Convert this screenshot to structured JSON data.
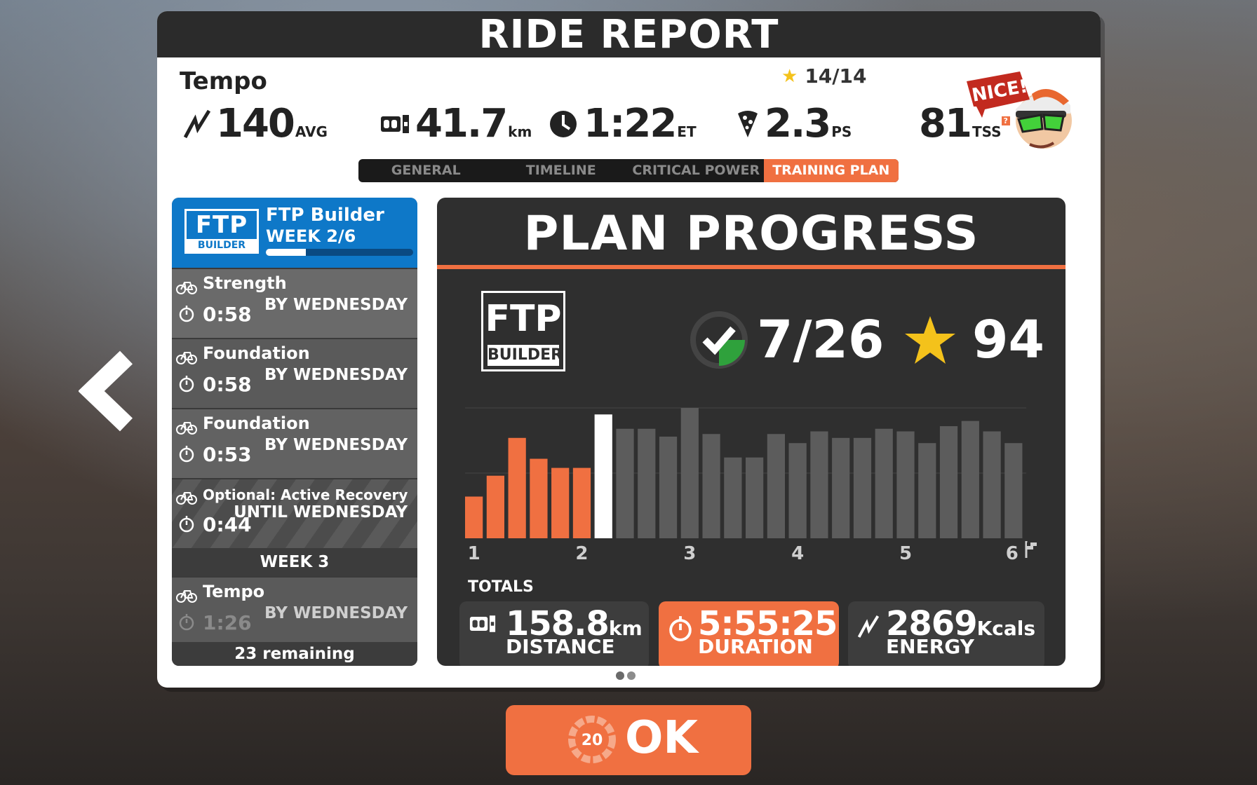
{
  "header": {
    "title": "RIDE REPORT"
  },
  "ride": {
    "name": "Tempo",
    "stars": "14/14",
    "power": "140",
    "power_unit": "AVG",
    "distance": "41.7",
    "distance_unit": "km",
    "time": "1:22",
    "time_unit": "ET",
    "pizza": "2.3",
    "pizza_unit": "PS",
    "tss": "81",
    "tss_unit": "TSS",
    "tss_help": "?",
    "badge": "NICE!"
  },
  "tabs": [
    {
      "label": "GENERAL",
      "active": false
    },
    {
      "label": "TIMELINE",
      "active": false
    },
    {
      "label": "CRITICAL POWER",
      "active": false
    },
    {
      "label": "TRAINING PLAN",
      "active": true
    }
  ],
  "plan": {
    "logo_main": "FTP",
    "logo_sub": "BUILDER",
    "name": "FTP Builder",
    "week": "WEEK 2/6",
    "progress": 0.27,
    "workouts": [
      {
        "name": "Strength",
        "time": "0:58",
        "due": "BY WEDNESDAY"
      },
      {
        "name": "Foundation",
        "time": "0:58",
        "due": "BY WEDNESDAY"
      },
      {
        "name": "Foundation",
        "time": "0:53",
        "due": "BY WEDNESDAY"
      },
      {
        "name": "Optional: Active Recovery",
        "time": "0:44",
        "due": "UNTIL WEDNESDAY"
      }
    ],
    "next_week_label": "WEEK 3",
    "next_workout": {
      "name": "Tempo",
      "time": "1:26",
      "due": "BY WEDNESDAY"
    },
    "remaining": "23 remaining"
  },
  "progress": {
    "title": "PLAN PROGRESS",
    "logo_main": "FTP",
    "logo_sub": "BUILDER",
    "completed": "7/26",
    "stars": "94",
    "totals_label": "TOTALS",
    "distance_value": "158.8",
    "distance_unit": "km",
    "distance_label": "DISTANCE",
    "duration_value": "5:55:25",
    "duration_label": "DURATION",
    "energy_value": "2869",
    "energy_unit": "Kcals",
    "energy_label": "ENERGY"
  },
  "colors": {
    "accent": "#f07041",
    "plan_blue": "#0e78c8",
    "dark": "#2f2f2f",
    "star": "#f4c21b",
    "check": "#2fa13c"
  },
  "ok_button": {
    "label": "OK",
    "countdown": "20"
  },
  "chart_data": {
    "type": "bar",
    "x_ticks": [
      "1",
      "2",
      "3",
      "4",
      "5",
      "6"
    ],
    "values": [
      0.32,
      0.48,
      0.77,
      0.61,
      0.54,
      0.54,
      0.95,
      0.84,
      0.84,
      0.78,
      1.0,
      0.8,
      0.62,
      0.62,
      0.8,
      0.73,
      0.82,
      0.77,
      0.77,
      0.84,
      0.82,
      0.73,
      0.86,
      0.9,
      0.82,
      0.73
    ],
    "completed_count": 6,
    "current_index": 6,
    "ylim": [
      0,
      1
    ]
  }
}
